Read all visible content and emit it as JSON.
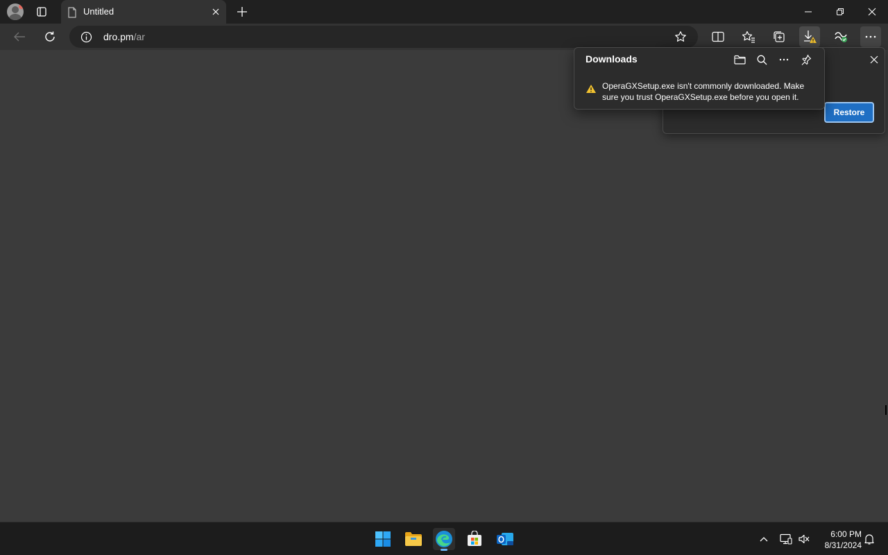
{
  "browser": {
    "tab": {
      "title": "Untitled"
    },
    "address": {
      "url_host": "dro.pm",
      "url_path": "/ar"
    }
  },
  "downloads_panel": {
    "title": "Downloads",
    "message": "OperaGXSetup.exe isn't commonly downloaded. Make sure you trust OperaGXSetup.exe before you open it."
  },
  "restore_panel": {
    "restore_label": "Restore"
  },
  "taskbar": {
    "time": "6:00 PM",
    "date": "8/31/2024"
  },
  "colors": {
    "accent": "#1f6fc4",
    "page_background": "#3b3b3b",
    "warning": "#f2c230"
  },
  "icons": [
    "profile-avatar",
    "tab-actions-icon",
    "page-icon",
    "close-icon",
    "plus-icon",
    "minimize-icon",
    "restore-icon",
    "back-arrow-icon",
    "refresh-icon",
    "info-icon",
    "star-icon",
    "split-screen-icon",
    "favorites-icon",
    "collections-icon",
    "download-icon",
    "copilot-icon",
    "more-icon",
    "folder-icon",
    "search-icon",
    "pin-icon",
    "warning-icon",
    "windows-start-icon",
    "file-explorer-icon",
    "edge-icon",
    "store-icon",
    "outlook-icon",
    "chevron-up-icon",
    "network-icon",
    "volume-icon",
    "bell-icon"
  ]
}
